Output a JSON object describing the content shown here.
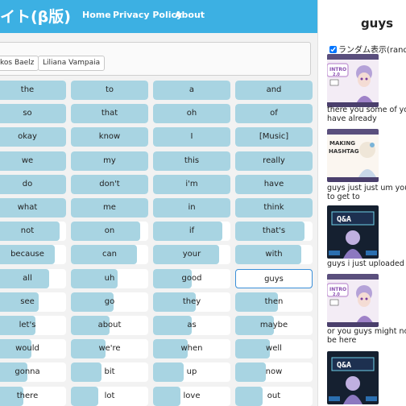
{
  "nav": {
    "brand": "イト(β版)",
    "links": [
      "Home",
      "Privacy Policy",
      "About"
    ]
  },
  "filters": {
    "chips": [
      "kos Baelz",
      "Liliana Vampaia"
    ]
  },
  "words": [
    [
      "the",
      "to",
      "a",
      "and"
    ],
    [
      "so",
      "that",
      "oh",
      "of"
    ],
    [
      "okay",
      "know",
      "I",
      "[Music]"
    ],
    [
      "we",
      "my",
      "this",
      "really"
    ],
    [
      "do",
      "don't",
      "i'm",
      "have"
    ],
    [
      "what",
      "me",
      "in",
      "think"
    ],
    [
      "not",
      "on",
      "if",
      "that's"
    ],
    [
      "because",
      "can",
      "your",
      "with"
    ],
    [
      "all",
      "uh",
      "good",
      "guys"
    ],
    [
      "see",
      "go",
      "they",
      "then"
    ],
    [
      "let's",
      "about",
      "as",
      "maybe"
    ],
    [
      "would",
      "we're",
      "when",
      "well"
    ],
    [
      "gonna",
      "bit",
      "up",
      "now"
    ],
    [
      "there",
      "lot",
      "love",
      "out"
    ]
  ],
  "word_levels": [
    [
      1.0,
      1.0,
      1.0,
      1.0
    ],
    [
      1.0,
      1.0,
      1.0,
      1.0
    ],
    [
      1.0,
      1.0,
      1.0,
      1.0
    ],
    [
      1.0,
      1.0,
      1.0,
      1.0
    ],
    [
      1.0,
      1.0,
      1.0,
      1.0
    ],
    [
      1.0,
      1.0,
      1.0,
      1.0
    ],
    [
      0.92,
      0.9,
      0.9,
      0.9
    ],
    [
      0.85,
      0.85,
      0.85,
      0.85
    ],
    [
      0.78,
      0.6,
      0.5,
      0.0
    ],
    [
      0.65,
      0.55,
      0.55,
      0.55
    ],
    [
      0.6,
      0.5,
      0.5,
      0.5
    ],
    [
      0.55,
      0.45,
      0.45,
      0.45
    ],
    [
      0.5,
      0.4,
      0.4,
      0.4
    ],
    [
      0.45,
      0.35,
      0.35,
      0.35
    ]
  ],
  "selected_word": "guys",
  "detail": {
    "title": "guys",
    "random_label": "ランダム表示(rando",
    "random_checked": true,
    "results": [
      {
        "thumb": "thumb-intro-video",
        "caption": [
          "there you some of you",
          "have already"
        ]
      },
      {
        "thumb": "thumb-hashtag-video",
        "caption": [
          "guys just just um you k",
          "to get to"
        ]
      },
      {
        "thumb": "thumb-qa-video",
        "caption": [
          "guys i just uploaded the"
        ]
      },
      {
        "thumb": "thumb-intro-video",
        "caption": [
          "or you guys might not e",
          "be here"
        ]
      },
      {
        "thumb": "thumb-qa-video",
        "caption": []
      }
    ]
  }
}
